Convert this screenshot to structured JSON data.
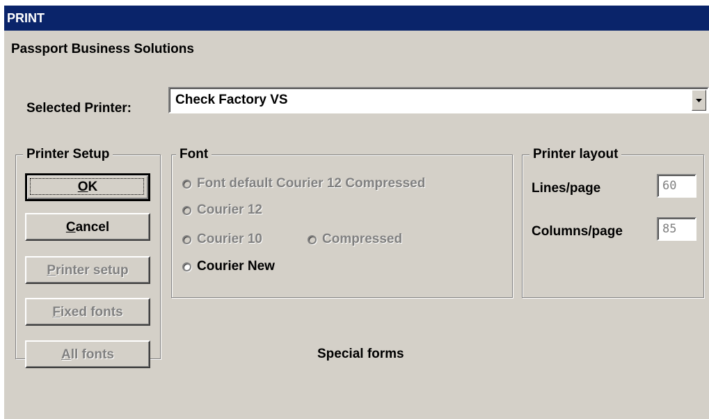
{
  "window": {
    "title": "PRINT"
  },
  "company": "Passport Business Solutions",
  "printer": {
    "label": "Selected Printer:",
    "value": "Check Factory VS"
  },
  "printer_setup": {
    "title": "Printer Setup",
    "buttons": {
      "ok": {
        "first": "O",
        "rest": "K"
      },
      "cancel": {
        "first": "C",
        "rest": "ancel"
      },
      "printer_setup": {
        "first": "P",
        "rest": "rinter setup"
      },
      "fixed_fonts": {
        "first": "F",
        "rest": "ixed fonts"
      },
      "all_fonts": {
        "first": "A",
        "rest": "ll fonts"
      }
    }
  },
  "font": {
    "title": "Font",
    "options": {
      "default": "Font default Courier 12 Compressed",
      "courier12": "Courier 12",
      "courier10": "Courier 10",
      "compressed": "Compressed",
      "courier_new": "Courier New"
    }
  },
  "layout": {
    "title": "Printer layout",
    "lines_label": "Lines/page",
    "lines_value": "60",
    "columns_label": "Columns/page",
    "columns_value": "85"
  },
  "special_forms": "Special forms"
}
